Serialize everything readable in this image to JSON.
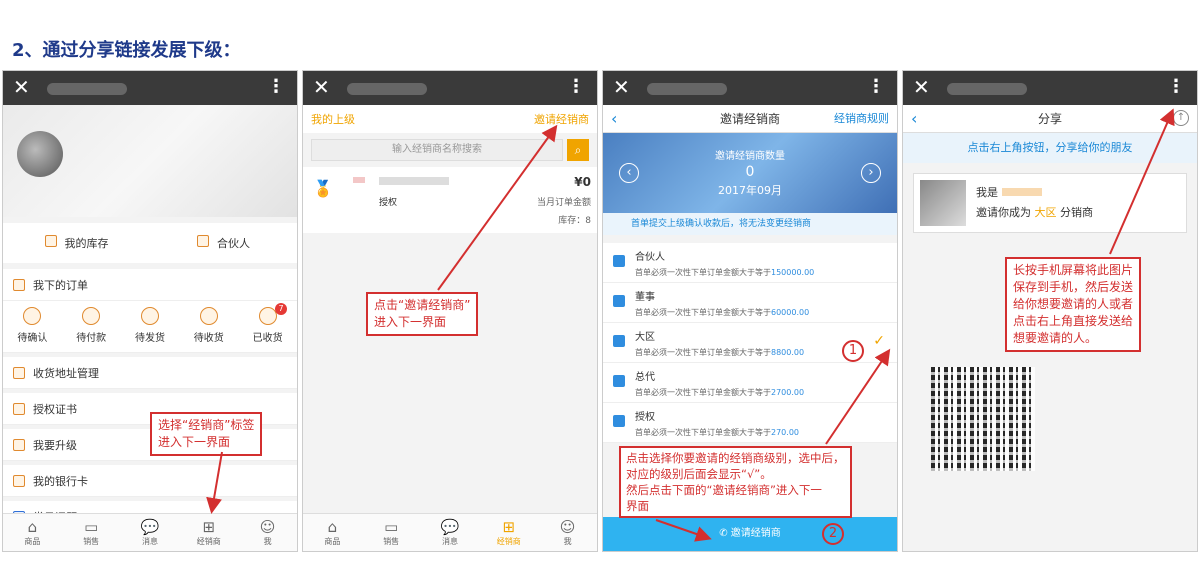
{
  "heading": "2、通过分享链接发展下级：",
  "tabs": [
    "商品",
    "销售",
    "消息",
    "经销商",
    "我"
  ],
  "p1": {
    "inventory": "我的库存",
    "partner": "合伙人",
    "my_orders": "我下的订单",
    "orders": [
      "待确认",
      "待付款",
      "待发货",
      "待收货",
      "已收货"
    ],
    "badge": "7",
    "menu": [
      "收货地址管理",
      "授权证书",
      "我要升级",
      "我的银行卡",
      "常见问题"
    ],
    "anno": "选择“经销商”标签\n进入下一界面"
  },
  "p2": {
    "my_superior": "我的上级",
    "invite": "邀请经销商",
    "search_placeholder": "输入经销商名称搜索",
    "dist_level": "授权",
    "dist_amount": "¥0",
    "dist_amount_label": "当月订单金额",
    "dist_stock": "库存：8",
    "anno": "点击“邀请经销商”\n进入下一界面"
  },
  "p3": {
    "title": "邀请经销商",
    "rules": "经销商规则",
    "count_label": "邀请经销商数量",
    "count": "0",
    "month": "2017年09月",
    "notice": "首单提交上级确认收款后，将无法变更经销商",
    "levels": [
      {
        "name": "合伙人",
        "desc": "首单必须一次性下单订单金额大于等于",
        "amount": "150000.00"
      },
      {
        "name": "董事",
        "desc": "首单必须一次性下单订单金额大于等于",
        "amount": "60000.00"
      },
      {
        "name": "大区",
        "desc": "首单必须一次性下单订单金额大于等于",
        "amount": "8800.00"
      },
      {
        "name": "总代",
        "desc": "首单必须一次性下单订单金额大于等于",
        "amount": "2700.00"
      },
      {
        "name": "授权",
        "desc": "首单必须一次性下单订单金额大于等于",
        "amount": "270.00"
      }
    ],
    "invite_btn": "邀请经销商",
    "num1": "1",
    "num2": "2",
    "anno": "点击选择你要邀请的经销商级别，选中后，\n对应的级别后面会显示“√”。\n然后点击下面的“邀请经销商”进入下一\n界面"
  },
  "p4": {
    "title": "分享",
    "hint": "点击右上角按钮，分享给你的朋友",
    "iam": "我是",
    "invite_text": "邀请你成为",
    "level": "大区",
    "role": "分销商",
    "anno": "长按手机屏幕将此图片\n保存到手机，然后发送\n给你想要邀请的人或者\n点击右上角直接发送给\n想要邀请的人。"
  }
}
